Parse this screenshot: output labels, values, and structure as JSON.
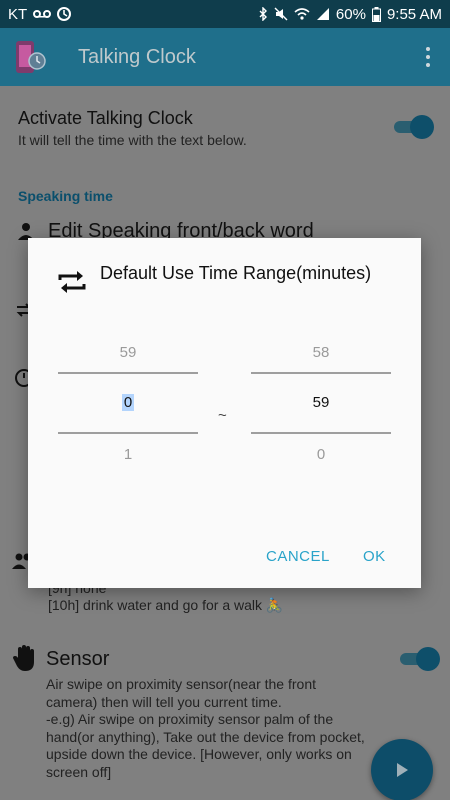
{
  "status_bar": {
    "carrier": "KT",
    "battery": "60%",
    "time": "9:55 AM"
  },
  "app_bar": {
    "title": "Talking Clock"
  },
  "background": {
    "activate_title": "Activate Talking Clock",
    "activate_desc": "It will tell the time with the text below.",
    "section_speaking": "Speaking time",
    "edit_word": "Edit Speaking front/back word",
    "schedule_line1": "[9h] none",
    "schedule_line2": "[10h] drink water and go for a walk 🚴",
    "sensor_title": "Sensor",
    "sensor_desc": "Air swipe on proximity sensor(near the front camera) then will tell you current time.\n-e.g) Air swipe on proximity sensor palm of the hand(or anything), Take out the device from pocket, upside down the device. [However, only works on screen off]"
  },
  "dialog": {
    "title": "Default Use Time Range(minutes)",
    "left_picker": {
      "prev": "59",
      "current": "0",
      "next": "1"
    },
    "right_picker": {
      "prev": "58",
      "current": "59",
      "next": "0"
    },
    "separator": "~",
    "cancel": "CANCEL",
    "ok": "OK"
  },
  "colors": {
    "accent": "#29a3c9",
    "appbar": "#1f6f8b",
    "statusbar": "#0f3d4c"
  },
  "icons": {
    "dialog": "repeat-icon",
    "fab": "play-icon"
  }
}
